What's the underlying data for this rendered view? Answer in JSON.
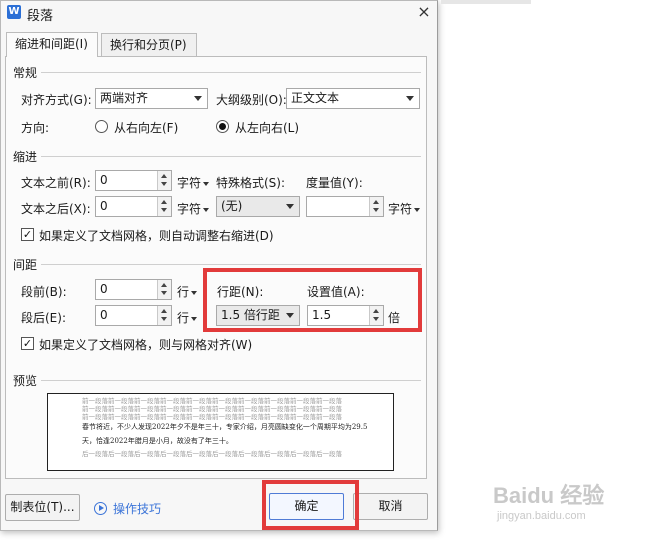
{
  "dialog": {
    "title": "段落",
    "app_icon_letter": "W",
    "close_glyph": "×"
  },
  "tabs": [
    {
      "label": "缩进和间距(I)",
      "active": true
    },
    {
      "label": "换行和分页(P)",
      "active": false
    }
  ],
  "general": {
    "title": "常规",
    "align_label": "对齐方式(G):",
    "align_value": "两端对齐",
    "outline_label": "大纲级别(O):",
    "outline_value": "正文文本",
    "direction_label": "方向:",
    "rtl_label": "从右向左(F)",
    "ltr_label": "从左向右(L)",
    "direction_selected": "ltr"
  },
  "indent": {
    "title": "缩进",
    "before_label": "文本之前(R):",
    "before_value": "0",
    "before_unit": "字符",
    "after_label": "文本之后(X):",
    "after_value": "0",
    "after_unit": "字符",
    "special_label": "特殊格式(S):",
    "special_value": "(无)",
    "measure_label": "度量值(Y):",
    "measure_value": "",
    "measure_unit": "字符",
    "auto_adjust_label": "如果定义了文档网格，则自动调整右缩进(D)",
    "auto_adjust_checked": true
  },
  "spacing": {
    "title": "间距",
    "before_label": "段前(B):",
    "before_value": "0",
    "before_unit": "行",
    "after_label": "段后(E):",
    "after_value": "0",
    "after_unit": "行",
    "line_spacing_label": "行距(N):",
    "line_spacing_value": "1.5 倍行距",
    "set_value_label": "设置值(A):",
    "set_value": "1.5",
    "set_value_unit": "倍",
    "snap_grid_label": "如果定义了文档网格，则与网格对齐(W)",
    "snap_grid_checked": true
  },
  "preview": {
    "title": "预览",
    "prev_line_1": "前一段落前一段落前一段落前一段落前一段落前一段落前一段落前一段落前一段落前一段落",
    "prev_line_2": "前一段落前一段落前一段落前一段落前一段落前一段落前一段落前一段落前一段落前一段落",
    "prev_line_3": "前一段落前一段落前一段落前一段落前一段落前一段落前一段落前一段落前一段落前一段落",
    "main_line_1": "春节将近，不少人发现2022年夕不是年三十，专家介绍，月亮圆缺变化一个周期平均为29.5",
    "main_line_2": "天，恰逢2022年腊月是小月，故没有了年三十。",
    "next_line_1": "后一段落后一段落后一段落后一段落后一段落后一段落后一段落后一段落后一段落后一段落"
  },
  "footer": {
    "tabs_button": "制表位(T)...",
    "tips_link": "操作技巧",
    "ok_button": "确定",
    "cancel_button": "取消"
  },
  "watermark": {
    "brand": "Baidu 经验",
    "sub": "jingyan.baidu.com"
  },
  "colors": {
    "highlight_red": "#e23b3b",
    "accent_blue": "#3b74d8"
  }
}
